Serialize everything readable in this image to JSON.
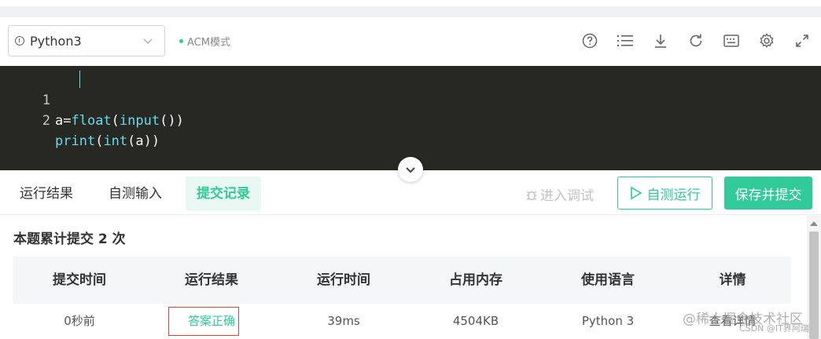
{
  "toolbar": {
    "language": "Python3",
    "mode_label": "ACM模式",
    "icons": [
      "help-icon",
      "list-icon",
      "download-icon",
      "refresh-icon",
      "keyboard-icon",
      "settings-icon",
      "fullscreen-icon"
    ]
  },
  "editor": {
    "lines": [
      {
        "no": "1",
        "parts": [
          "a=",
          "float",
          "(",
          "input",
          "())"
        ]
      },
      {
        "no": "2",
        "parts": [
          "print",
          "(",
          "int",
          "(a))"
        ]
      }
    ]
  },
  "tabs": [
    {
      "label": "运行结果",
      "active": false
    },
    {
      "label": "自测输入",
      "active": false
    },
    {
      "label": "提交记录",
      "active": true
    }
  ],
  "actions": {
    "debug": "进入调试",
    "test_run": "自测运行",
    "save_submit": "保存并提交"
  },
  "records": {
    "title": "本题累计提交 2 次",
    "columns": [
      "提交时间",
      "运行结果",
      "运行时间",
      "占用内存",
      "使用语言",
      "详情"
    ],
    "rows": [
      {
        "time": "0秒前",
        "result": "答案正确",
        "runtime": "39ms",
        "memory": "4504KB",
        "language": "Python 3",
        "detail": "查看详情"
      }
    ]
  },
  "colors": {
    "accent": "#32ca99",
    "editor_bg": "#272822",
    "highlight_box": "#d64545"
  },
  "watermark": {
    "main": "@稀土掘金技术社区",
    "sub": "CSDN @IT界阿瑞"
  }
}
